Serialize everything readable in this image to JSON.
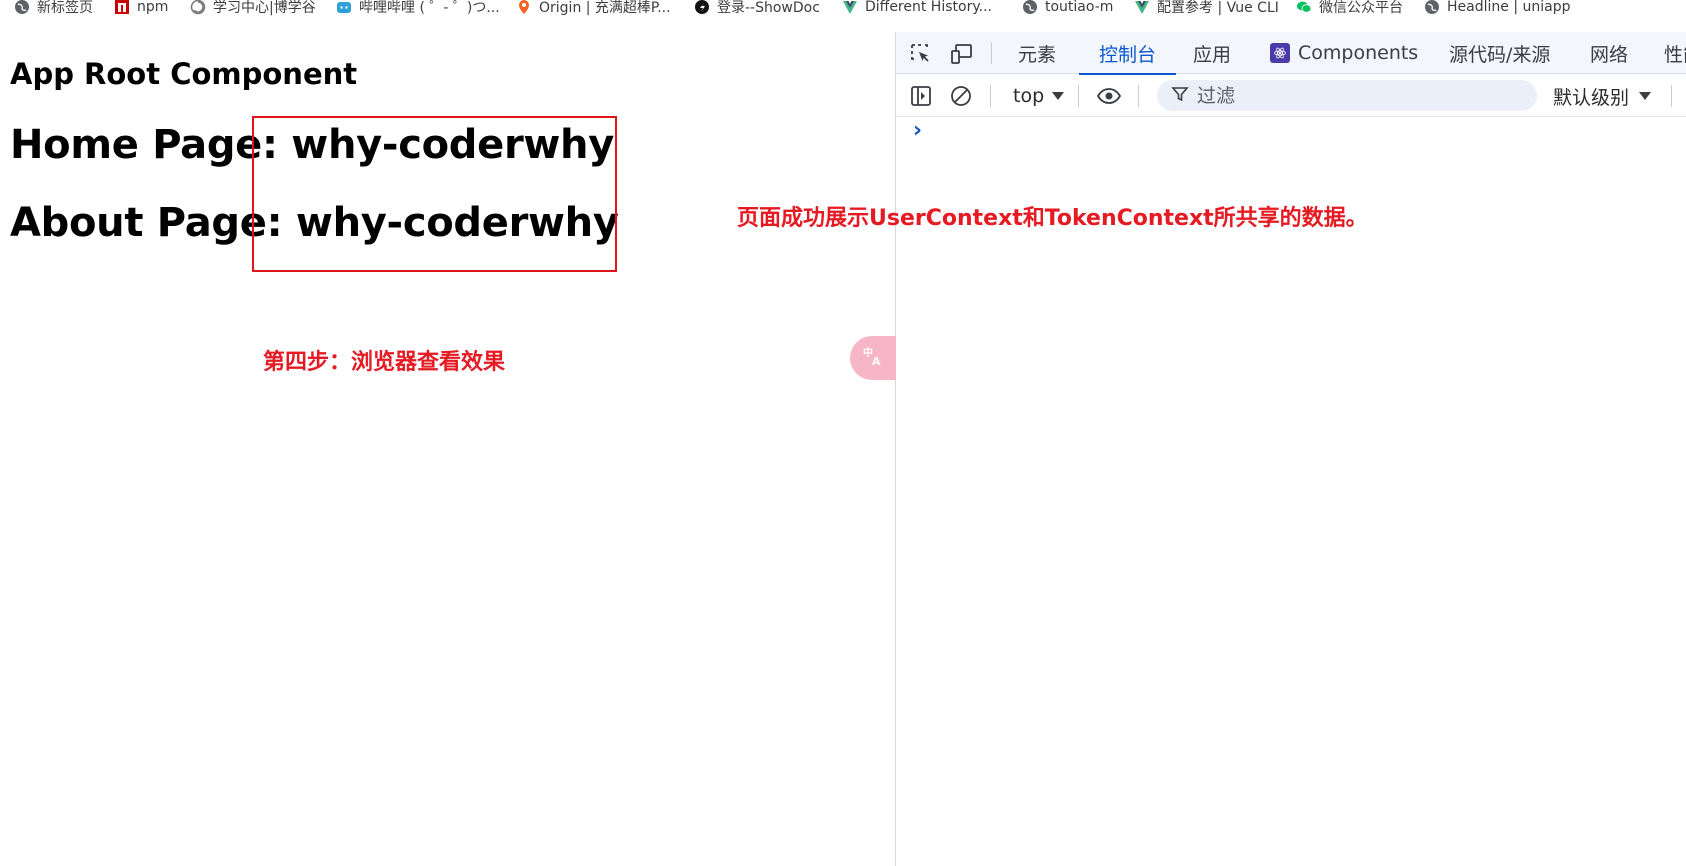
{
  "bookmarks": [
    {
      "label": "新标签页",
      "icon": "globe-icon"
    },
    {
      "label": "npm",
      "icon": "npm-icon"
    },
    {
      "label": "学习中心|博学谷",
      "icon": "spiral-icon"
    },
    {
      "label": "哔哩哔哩 ( ゜- ゜)つ...",
      "icon": "bilibili-icon"
    },
    {
      "label": "Origin | 充满超棒P...",
      "icon": "location-pin-icon"
    },
    {
      "label": "登录--ShowDoc",
      "icon": "showdoc-icon"
    },
    {
      "label": "Different History...",
      "icon": "vue-icon"
    },
    {
      "label": "toutiao-m",
      "icon": "globe-icon"
    },
    {
      "label": "配置参考 | Vue CLI",
      "icon": "vue-icon"
    },
    {
      "label": "微信公众平台",
      "icon": "wechat-icon"
    },
    {
      "label": "Headline | uniapp",
      "icon": "globe-icon"
    }
  ],
  "page": {
    "root_heading": "App Root Component",
    "home_line": "Home Page: why-coderwhy",
    "about_line": "About Page: why-coderwhy",
    "note_step": "第四步：浏览器查看效果",
    "note_result": "页面成功展示UserContext和TokenContext所共享的数据。"
  },
  "devtools": {
    "tabs": [
      {
        "label": "元素"
      },
      {
        "label": "控制台",
        "active": true
      },
      {
        "label": "应用"
      },
      {
        "label": "Components",
        "icon": "react-icon"
      },
      {
        "label": "源代码/来源"
      },
      {
        "label": "网络"
      },
      {
        "label": "性能"
      }
    ],
    "context": "top",
    "filter_placeholder": "过滤",
    "level": "默认级别",
    "prompt": "›"
  },
  "colors": {
    "accent": "#0b57d0",
    "annotation_red": "#e51a22"
  }
}
